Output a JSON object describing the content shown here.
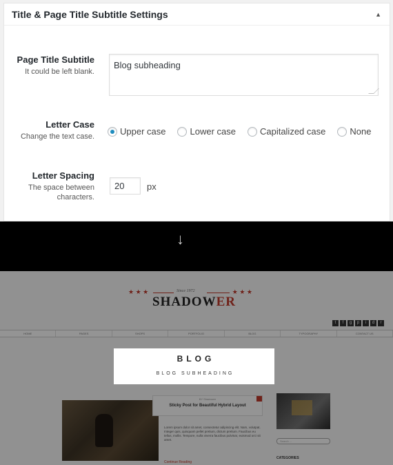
{
  "settings": {
    "title": "Title & Page Title Subtitle Settings",
    "subtitle": {
      "label": "Page Title Subtitle",
      "description": "It could be left blank.",
      "value": "Blog subheading"
    },
    "letter_case": {
      "label": "Letter Case",
      "description": "Change the text case.",
      "options": [
        "Upper case",
        "Lower case",
        "Capitalized case",
        "None"
      ],
      "selected": "Upper case"
    },
    "letter_spacing": {
      "label": "Letter Spacing",
      "description": "The space between characters.",
      "value": "20",
      "unit": "px"
    }
  },
  "preview": {
    "since": "Since 1972",
    "logo_main": "SHADOW",
    "logo_accent": "ER",
    "nav": [
      "HOME",
      "PAGES",
      "SHOPS",
      "PORTFOLIO",
      "BLOG",
      "TYPOGRAPHY",
      "CONTACT US"
    ],
    "hero_title": "BLOG",
    "hero_subtitle": "BLOG SUBHEADING",
    "post_meta": "BY Shadower",
    "post_title": "Sticky Post for Beautiful Hybrid Layout",
    "post_text": "Lorem ipsum dolor sit amet, consectetur adipiscing elit. Nam, volutpat. Integer quis, quisquam pellet pretium, dictum pretium. Faucibus eu tellus, mollis. Tempore, nulla viverra faucibus pulvinar, euismod orci sit amet.",
    "read_more": "Continue Reading",
    "search_placeholder": "Search ...",
    "categories_label": "CATEGORIES"
  },
  "colors": {
    "radio_selected": "#1e8cbe",
    "brand_accent": "#c0392b"
  }
}
